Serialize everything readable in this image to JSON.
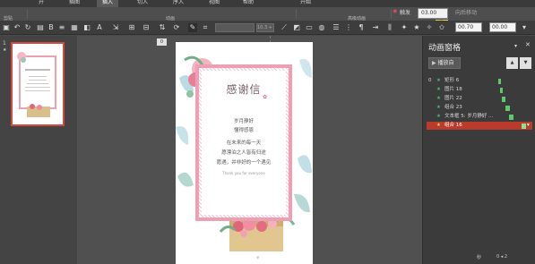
{
  "ribbon": {
    "tabs": [
      {
        "label": "开"
      },
      {
        "label": "插图"
      },
      {
        "label": "插入",
        "active": true
      },
      {
        "label": "切入"
      },
      {
        "label": "序入"
      },
      {
        "label": "视图"
      },
      {
        "label": "帮助"
      },
      {
        "label": "开始"
      }
    ],
    "group_label_edit": "剪贴",
    "group_label_anim": "动画",
    "group_label_advanced": "高级动画",
    "trigger_label": "触发",
    "duration_value": "03.00",
    "duration_hint": "时间",
    "reorder_label": "向后移动"
  },
  "toolbar": {
    "width_value": "10.3 +",
    "num1": "00.70",
    "num2": "00.00"
  },
  "thumbnails": {
    "slide_number": "1",
    "star": "★"
  },
  "canvas": {
    "anchor_top": "0",
    "anchor_mid": "0",
    "anchor_low1": "0",
    "anchor_low2": "0"
  },
  "slide": {
    "title": "感谢信",
    "lines": [
      "岁月静好",
      "懂得感恩",
      "在未来的每一天",
      "愿漂泊之人皆有归途",
      "愿遇，并非好的一个遇见"
    ],
    "sub_en": "Thank you for everyone"
  },
  "pane": {
    "title": "动画窗格",
    "play_label": "播放自",
    "rows": [
      {
        "num": "0",
        "label": "矩形 6",
        "selected": false
      },
      {
        "num": "",
        "label": "图片 18",
        "selected": false
      },
      {
        "num": "",
        "label": "图片 22",
        "selected": false
      },
      {
        "num": "",
        "label": "组合 23",
        "selected": false
      },
      {
        "num": "",
        "label": "文本框 5: 岁月静好 ...",
        "selected": false
      },
      {
        "num": "",
        "label": "组合 16",
        "selected": true
      }
    ],
    "bottom_left": "秒",
    "bottom_right": "0 ◂ 2"
  }
}
